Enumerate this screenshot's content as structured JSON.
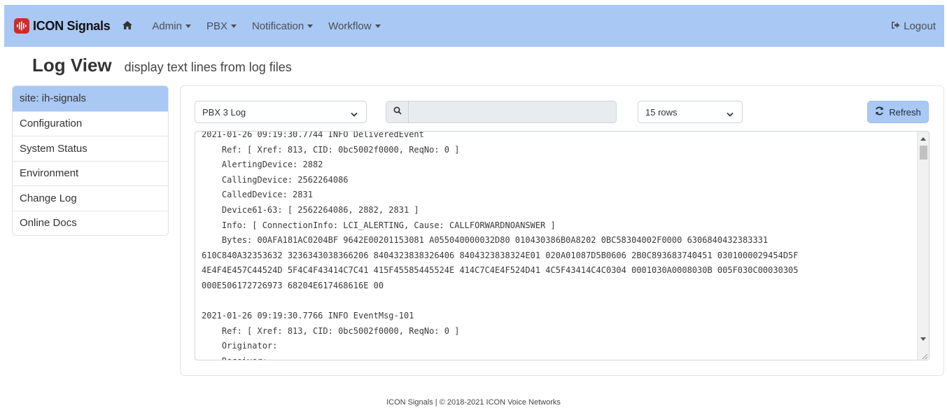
{
  "navbar": {
    "brand": "ICON Signals",
    "home_icon": "home-icon",
    "menus": [
      {
        "label": "Admin"
      },
      {
        "label": "PBX"
      },
      {
        "label": "Notification"
      },
      {
        "label": "Workflow"
      }
    ],
    "logout_label": "Logout",
    "logout_icon": "sign-out-icon",
    "color": "#a9c8f4"
  },
  "header": {
    "title": "Log View",
    "subtitle": "display text lines from log files"
  },
  "sidebar": {
    "items": [
      {
        "label": "site: ih-signals",
        "active": true
      },
      {
        "label": "Configuration"
      },
      {
        "label": "System Status"
      },
      {
        "label": "Environment"
      },
      {
        "label": "Change Log"
      },
      {
        "label": "Online Docs"
      }
    ]
  },
  "toolbar": {
    "log_select": "PBX 3 Log",
    "search_value": "",
    "rows_select": "15 rows",
    "refresh_label": "Refresh"
  },
  "log": {
    "text": "2021-01-26 09:19:30.7744 INFO DeliveredEvent\n    Ref: [ Xref: 813, CID: 0bc5002f0000, ReqNo: 0 ]\n    AlertingDevice: 2882\n    CallingDevice: 2562264086\n    CalledDevice: 2831\n    Device61-63: [ 2562264086, 2882, 2831 ]\n    Info: [ ConnectionInfo: LCI_ALERTING, Cause: CALLFORWARDNOANSWER ]\n    Bytes: 00AFA181AC0204BF 9642E00201153081 A055040000032D80 010430386B0A8202 0BC58304002F0000 6306840432383331\n610C840A32353632 3236343038366206 8404323838326406 8404323838324E01 020A01087D5B0606 2B0C893683740451 0301000029454D5F\n4E4F4E457C44524D 5F4C4F43414C7C41 415F45585445524E 414C7C4E4F524D41 4C5F43414C4C0304 0001030A0008030B 005F030C00030305\n000E506172726973 68204E617468616E 00\n\n2021-01-26 09:19:30.7766 INFO EventMsg-101\n    Ref: [ Xref: 813, CID: 0bc5002f0000, ReqNo: 0 ]\n    Originator:\n    Receiver:"
  },
  "footer": {
    "text": "ICON Signals | © 2018-2021 ICON Voice Networks"
  }
}
